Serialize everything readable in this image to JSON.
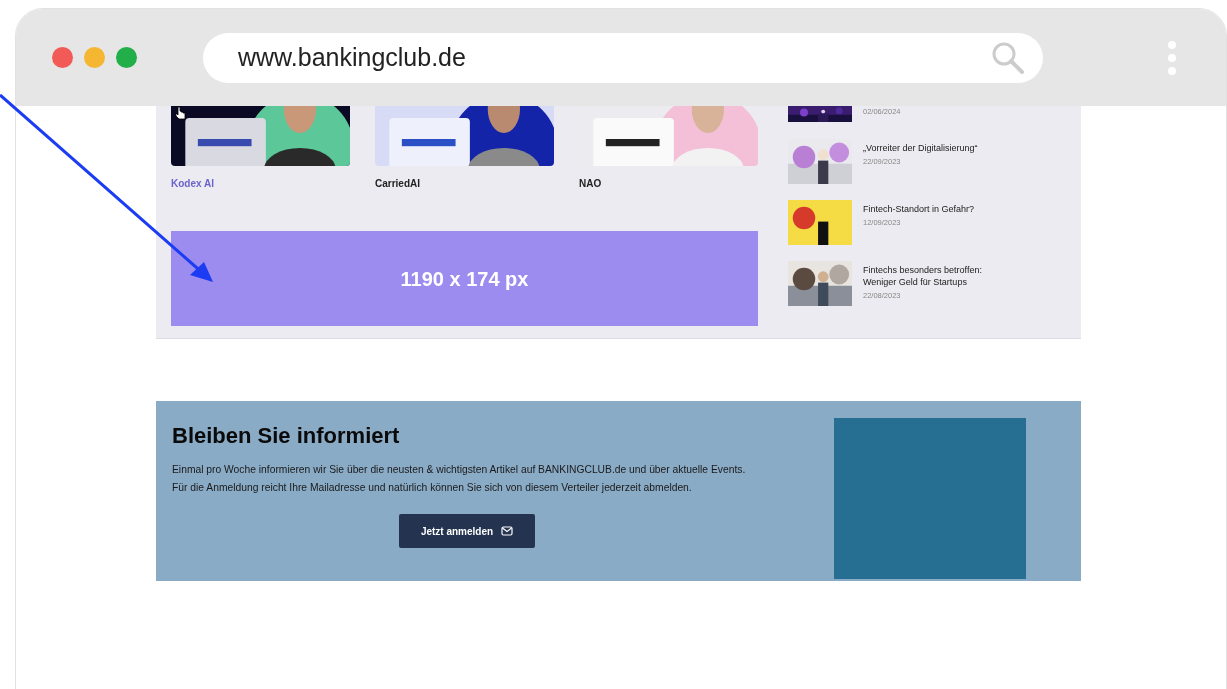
{
  "browser": {
    "url": "www.bankingclub.de"
  },
  "partners": [
    {
      "name": "Kodex AI",
      "hovered": true,
      "kind": "picture"
    },
    {
      "name": "CarriedAI",
      "hovered": false,
      "kind": "picture"
    },
    {
      "name": "NAO",
      "hovered": false,
      "kind": "picture"
    }
  ],
  "ad_banner": {
    "text": "1190 x 174 px"
  },
  "news": [
    {
      "date": "02/06/2024",
      "kind": "picture"
    },
    {
      "title": "„Vorreiter der Digitalisierung“",
      "date": "22/09/2023",
      "kind": "picture"
    },
    {
      "title": "Fintech-Standort in Gefahr?",
      "date": "12/09/2023",
      "kind": "picture"
    },
    {
      "title": "Fintechs besonders betroffen: Weniger Geld für Startups",
      "date": "22/08/2023",
      "kind": "picture"
    }
  ],
  "newsletter": {
    "heading": "Bleiben Sie informiert",
    "text": "Einmal pro Woche informieren wir Sie über die neusten & wichtigsten Artikel auf BANKINGCLUB.de und über aktuelle Events. Für die Anmeldung reicht Ihre Mailadresse und natürlich können Sie sich von diesem Verteiler jederzeit abmelden.",
    "button": "Jetzt anmelden"
  }
}
